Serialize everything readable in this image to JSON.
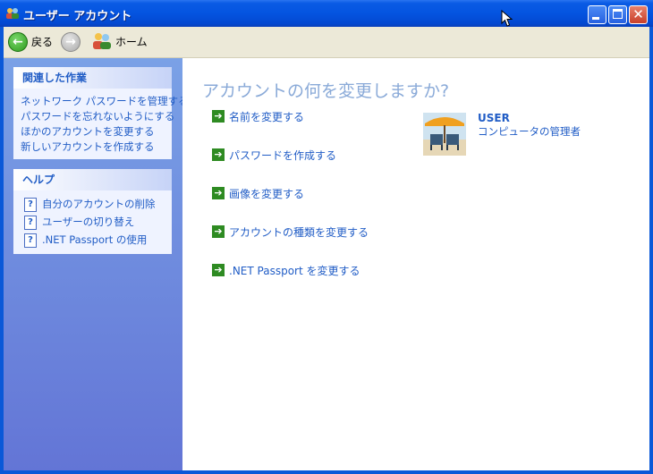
{
  "window": {
    "title": "ユーザー アカウント",
    "icon": "user-accounts-icon"
  },
  "toolbar": {
    "back_label": "戻る",
    "home_label": "ホーム"
  },
  "sidebar": {
    "related_tasks": {
      "header": "関連した作業",
      "items": [
        "ネットワーク パスワードを管理する",
        "パスワードを忘れないようにする",
        "ほかのアカウントを変更する",
        "新しいアカウントを作成する"
      ]
    },
    "help": {
      "header": "ヘルプ",
      "items": [
        "自分のアカウントの削除",
        "ユーザーの切り替え",
        ".NET Passport の使用"
      ]
    }
  },
  "main": {
    "heading": "アカウントの何を変更しますか?",
    "actions": [
      "名前を変更する",
      "パスワードを作成する",
      "画像を変更する",
      "アカウントの種類を変更する",
      ".NET Passport を変更する"
    ],
    "user": {
      "name": "USER",
      "role": "コンピュータの管理者"
    }
  },
  "colors": {
    "link": "#215DC6",
    "heading": "#8AAAD8",
    "titlebar": "#0454E0",
    "sidebar_top": "#7AA1E6",
    "sidebar_bottom": "#6375D6",
    "arrow": "#2E8B22"
  }
}
